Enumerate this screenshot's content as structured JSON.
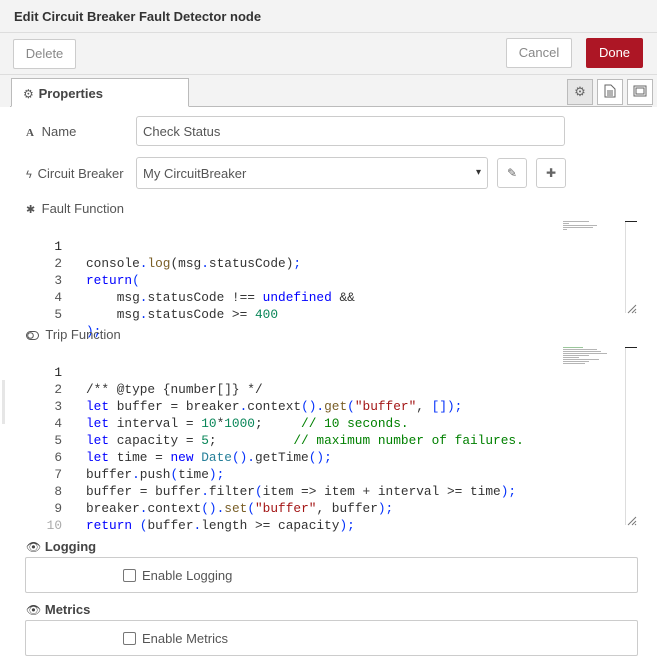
{
  "title": "Edit Circuit Breaker Fault Detector node",
  "toolbar": {
    "delete_label": "Delete",
    "cancel_label": "Cancel",
    "done_label": "Done"
  },
  "tabs": {
    "properties_label": "Properties"
  },
  "fields": {
    "name_label": "Name",
    "name_value": "Check Status",
    "breaker_label": "Circuit Breaker",
    "breaker_value": "My CircuitBreaker"
  },
  "fault_function": {
    "label": "Fault Function",
    "lines": [
      "1",
      "2",
      "3",
      "4",
      "5"
    ]
  },
  "trip_function": {
    "label": "Trip Function",
    "lines": [
      "1",
      "2",
      "3",
      "4",
      "5",
      "6",
      "7",
      "8",
      "9",
      "10"
    ]
  },
  "logging": {
    "label": "Logging",
    "checkbox_label": "Enable Logging"
  },
  "metrics": {
    "label": "Metrics",
    "checkbox_label": "Enable Metrics"
  },
  "icons": {
    "properties": "gear-icon",
    "name": "font-icon",
    "breaker": "bolt-icon",
    "fault": "bug-icon",
    "trip": "toggle-icon",
    "logging": "eye-icon",
    "metrics": "eye-icon"
  },
  "colors": {
    "accent": "#ad1625"
  }
}
